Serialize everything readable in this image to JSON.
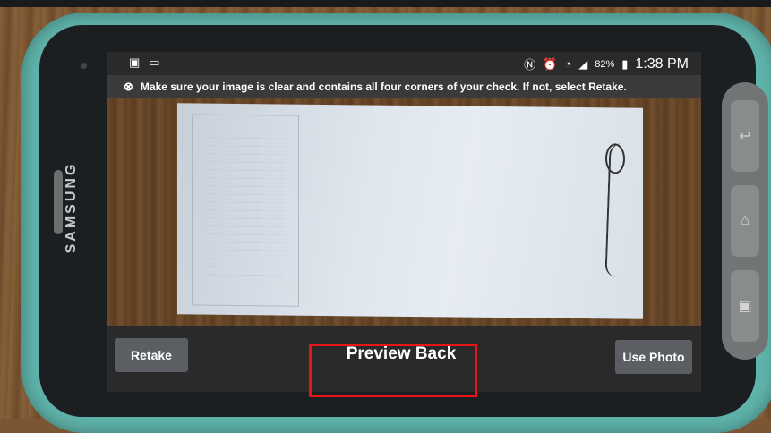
{
  "device": {
    "brand": "SAMSUNG"
  },
  "status_bar": {
    "left_icons": [
      "save-icon",
      "image-icon"
    ],
    "right_icons": [
      "nfc-icon",
      "alarm-icon",
      "wifi-icon",
      "signal-icon"
    ],
    "battery": "82%",
    "time": "1:38 PM"
  },
  "notice": {
    "text": "Make sure your image is clear and contains all four corners of your check. If not, select Retake."
  },
  "bottom_bar": {
    "retake_label": "Retake",
    "title": "Preview Back",
    "use_photo_label": "Use Photo"
  },
  "colors": {
    "case": "#5fb3aa",
    "highlight": "#e81416"
  }
}
